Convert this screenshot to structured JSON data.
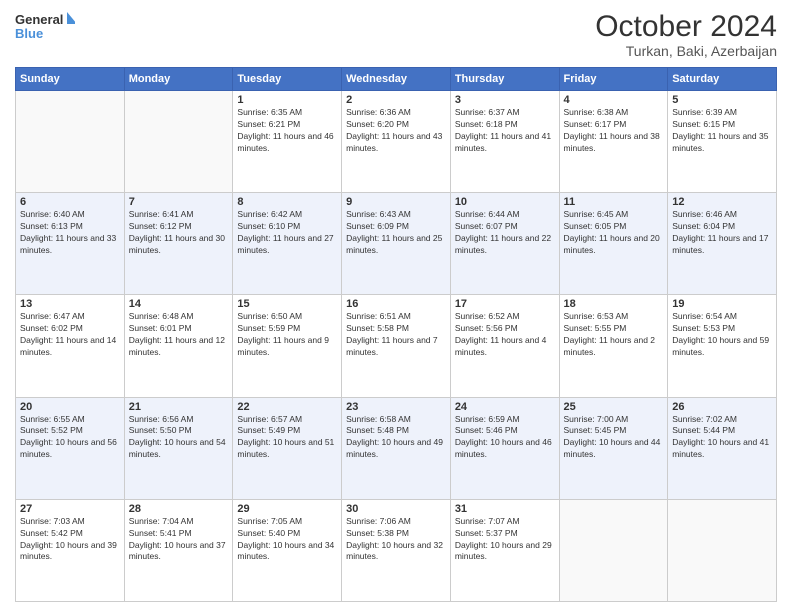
{
  "header": {
    "logo_line1": "General",
    "logo_line2": "Blue",
    "title": "October 2024",
    "subtitle": "Turkan, Baki, Azerbaijan"
  },
  "days_of_week": [
    "Sunday",
    "Monday",
    "Tuesday",
    "Wednesday",
    "Thursday",
    "Friday",
    "Saturday"
  ],
  "weeks": [
    [
      {
        "day": "",
        "info": ""
      },
      {
        "day": "",
        "info": ""
      },
      {
        "day": "1",
        "info": "Sunrise: 6:35 AM\nSunset: 6:21 PM\nDaylight: 11 hours and 46 minutes."
      },
      {
        "day": "2",
        "info": "Sunrise: 6:36 AM\nSunset: 6:20 PM\nDaylight: 11 hours and 43 minutes."
      },
      {
        "day": "3",
        "info": "Sunrise: 6:37 AM\nSunset: 6:18 PM\nDaylight: 11 hours and 41 minutes."
      },
      {
        "day": "4",
        "info": "Sunrise: 6:38 AM\nSunset: 6:17 PM\nDaylight: 11 hours and 38 minutes."
      },
      {
        "day": "5",
        "info": "Sunrise: 6:39 AM\nSunset: 6:15 PM\nDaylight: 11 hours and 35 minutes."
      }
    ],
    [
      {
        "day": "6",
        "info": "Sunrise: 6:40 AM\nSunset: 6:13 PM\nDaylight: 11 hours and 33 minutes."
      },
      {
        "day": "7",
        "info": "Sunrise: 6:41 AM\nSunset: 6:12 PM\nDaylight: 11 hours and 30 minutes."
      },
      {
        "day": "8",
        "info": "Sunrise: 6:42 AM\nSunset: 6:10 PM\nDaylight: 11 hours and 27 minutes."
      },
      {
        "day": "9",
        "info": "Sunrise: 6:43 AM\nSunset: 6:09 PM\nDaylight: 11 hours and 25 minutes."
      },
      {
        "day": "10",
        "info": "Sunrise: 6:44 AM\nSunset: 6:07 PM\nDaylight: 11 hours and 22 minutes."
      },
      {
        "day": "11",
        "info": "Sunrise: 6:45 AM\nSunset: 6:05 PM\nDaylight: 11 hours and 20 minutes."
      },
      {
        "day": "12",
        "info": "Sunrise: 6:46 AM\nSunset: 6:04 PM\nDaylight: 11 hours and 17 minutes."
      }
    ],
    [
      {
        "day": "13",
        "info": "Sunrise: 6:47 AM\nSunset: 6:02 PM\nDaylight: 11 hours and 14 minutes."
      },
      {
        "day": "14",
        "info": "Sunrise: 6:48 AM\nSunset: 6:01 PM\nDaylight: 11 hours and 12 minutes."
      },
      {
        "day": "15",
        "info": "Sunrise: 6:50 AM\nSunset: 5:59 PM\nDaylight: 11 hours and 9 minutes."
      },
      {
        "day": "16",
        "info": "Sunrise: 6:51 AM\nSunset: 5:58 PM\nDaylight: 11 hours and 7 minutes."
      },
      {
        "day": "17",
        "info": "Sunrise: 6:52 AM\nSunset: 5:56 PM\nDaylight: 11 hours and 4 minutes."
      },
      {
        "day": "18",
        "info": "Sunrise: 6:53 AM\nSunset: 5:55 PM\nDaylight: 11 hours and 2 minutes."
      },
      {
        "day": "19",
        "info": "Sunrise: 6:54 AM\nSunset: 5:53 PM\nDaylight: 10 hours and 59 minutes."
      }
    ],
    [
      {
        "day": "20",
        "info": "Sunrise: 6:55 AM\nSunset: 5:52 PM\nDaylight: 10 hours and 56 minutes."
      },
      {
        "day": "21",
        "info": "Sunrise: 6:56 AM\nSunset: 5:50 PM\nDaylight: 10 hours and 54 minutes."
      },
      {
        "day": "22",
        "info": "Sunrise: 6:57 AM\nSunset: 5:49 PM\nDaylight: 10 hours and 51 minutes."
      },
      {
        "day": "23",
        "info": "Sunrise: 6:58 AM\nSunset: 5:48 PM\nDaylight: 10 hours and 49 minutes."
      },
      {
        "day": "24",
        "info": "Sunrise: 6:59 AM\nSunset: 5:46 PM\nDaylight: 10 hours and 46 minutes."
      },
      {
        "day": "25",
        "info": "Sunrise: 7:00 AM\nSunset: 5:45 PM\nDaylight: 10 hours and 44 minutes."
      },
      {
        "day": "26",
        "info": "Sunrise: 7:02 AM\nSunset: 5:44 PM\nDaylight: 10 hours and 41 minutes."
      }
    ],
    [
      {
        "day": "27",
        "info": "Sunrise: 7:03 AM\nSunset: 5:42 PM\nDaylight: 10 hours and 39 minutes."
      },
      {
        "day": "28",
        "info": "Sunrise: 7:04 AM\nSunset: 5:41 PM\nDaylight: 10 hours and 37 minutes."
      },
      {
        "day": "29",
        "info": "Sunrise: 7:05 AM\nSunset: 5:40 PM\nDaylight: 10 hours and 34 minutes."
      },
      {
        "day": "30",
        "info": "Sunrise: 7:06 AM\nSunset: 5:38 PM\nDaylight: 10 hours and 32 minutes."
      },
      {
        "day": "31",
        "info": "Sunrise: 7:07 AM\nSunset: 5:37 PM\nDaylight: 10 hours and 29 minutes."
      },
      {
        "day": "",
        "info": ""
      },
      {
        "day": "",
        "info": ""
      }
    ]
  ]
}
